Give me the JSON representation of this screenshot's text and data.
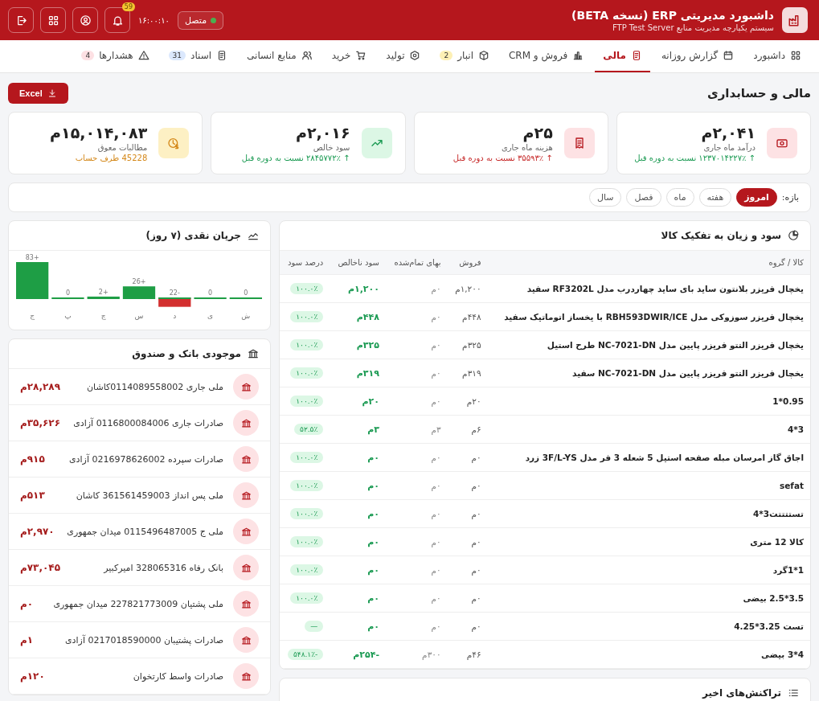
{
  "header": {
    "title": "داشبورد مدیریتی ERP (نسخه BETA)",
    "subtitle": "سیستم یکپارچه مدیریت منابع FTP Test Server",
    "status": {
      "label": "متصل",
      "online": true
    },
    "time": "۱۶:۰۰:۱۰",
    "notifications": "59"
  },
  "nav": [
    {
      "label": "داشبورد",
      "selected": false
    },
    {
      "label": "گزارش روزانه",
      "selected": false
    },
    {
      "label": "مالی",
      "selected": true
    },
    {
      "label": "فروش و CRM",
      "selected": false
    },
    {
      "label": "انبار",
      "selected": false,
      "badge": "2",
      "color": "#fdf0b5"
    },
    {
      "label": "تولید",
      "selected": false
    },
    {
      "label": "خرید",
      "selected": false
    },
    {
      "label": "منابع انسانی",
      "selected": false
    },
    {
      "label": "اسناد",
      "selected": false,
      "badge": "31",
      "color": "#dbe8fd"
    },
    {
      "label": "هشدارها",
      "selected": false,
      "badge": "4",
      "color": "#fde0e3"
    }
  ],
  "page": {
    "title": "مالی و حسابداری",
    "export_button": "Excel"
  },
  "kpis": [
    {
      "value": "۲,۰۴۱م",
      "label": "درآمد ماه جاری",
      "change": {
        "text": "↑ ۱۲۳۷۰۱۴۲۲۷٪ نسبت به دوره قبل",
        "color": "#1a9a52"
      },
      "color": "#fde2e4"
    },
    {
      "value": "۲۵م",
      "label": "هزینه ماه جاری",
      "change": {
        "text": "↑ ۳۵۵۹۳٪ نسبت به دوره قبل",
        "color": "#c62828"
      },
      "color": "#fde2e4"
    },
    {
      "value": "۲,۰۱۶م",
      "label": "سود خالص",
      "change": {
        "text": "↑ ۲۸۴۵۷۷۲٪ نسبت به دوره قبل",
        "color": "#1a9a52"
      },
      "color": "#dcf7e5"
    },
    {
      "value": "۱۵,۰۱۴,۰۸۳م",
      "label": "مطالبات معوق",
      "change": {
        "text": "45228 طرف حساب",
        "color": "#d4881a"
      },
      "color": "#fdf0c4"
    }
  ],
  "period": {
    "label": "بازه:",
    "options": [
      {
        "label": "امروز",
        "selected": true
      },
      {
        "label": "هفته",
        "selected": false
      },
      {
        "label": "ماه",
        "selected": false
      },
      {
        "label": "فصل",
        "selected": false
      },
      {
        "label": "سال",
        "selected": false
      }
    ]
  },
  "profit_table": {
    "title": "سود و زیان به تفکیک کالا",
    "columns": [
      "کالا / گروه",
      "فروش",
      "بهای تمام‌شده",
      "سود ناخالص",
      "درصد سود"
    ],
    "rows": [
      [
        "یخچال فریزر بلانتون ساید بای ساید چهاردرب مدل RF3202L سفید",
        "۱,۲۰۰م",
        "۰م",
        "۱,۲۰۰م",
        "۱۰۰.۰٪"
      ],
      [
        "یخچال فریزر سوزوکی مدل RBH593DWIR/ICE با یخساز اتوماتیک سفید",
        "۴۴۸م",
        "۰م",
        "۴۴۸م",
        "۱۰۰.۰٪"
      ],
      [
        "یخچال فریزر التتو فریزر پایین مدل NC-7021-DN طرح استیل",
        "۳۲۵م",
        "۰م",
        "۳۲۵م",
        "۱۰۰.۰٪"
      ],
      [
        "یخچال فریزر التتو فریزر پایین مدل NC-7021-DN سفید",
        "۳۱۹م",
        "۰م",
        "۳۱۹م",
        "۱۰۰.۰٪"
      ],
      [
        "0.95*1",
        "۲۰م",
        "۰م",
        "۲۰م",
        "۱۰۰.۰٪"
      ],
      [
        "3*4",
        "۶م",
        "۳م",
        "۳م",
        "۵۲.۵٪"
      ],
      [
        "اجاق گاز امرسان مبله صفحه استیل 5 شعله 3 فر مدل 3F/L-YS زرد",
        "۰م",
        "۰م",
        "۰م",
        "۱۰۰.۰٪"
      ],
      [
        "sefat",
        "۰م",
        "۰م",
        "۰م",
        "۱۰۰.۰٪"
      ],
      [
        "تستتتتت3*4",
        "۰م",
        "۰م",
        "۰م",
        "۱۰۰.۰٪"
      ],
      [
        "کالا 12 متری",
        "۰م",
        "۰م",
        "۰م",
        "۱۰۰.۰٪"
      ],
      [
        "1*1گرد",
        "۰م",
        "۰م",
        "۰م",
        "۱۰۰.۰٪"
      ],
      [
        "3.5*2.5 بیضی",
        "۰م",
        "۰م",
        "۰م",
        "۱۰۰.۰٪"
      ],
      [
        "تست 3.25*4.25",
        "۰م",
        "۰م",
        "۰م",
        "—"
      ],
      [
        "4*3 بیضی",
        "۴۶م",
        "۳۰۰م",
        "-۲۵۴م",
        "-۵۴۸.۱٪"
      ]
    ]
  },
  "transactions": {
    "title": "تراکنش‌های اخیر"
  },
  "cash_flow": {
    "title": "جریان نقدی (۷ روز)",
    "chart_data": {
      "type": "bar",
      "categories": [
        "ج",
        "پ",
        "چ",
        "س",
        "د",
        "ی",
        "ش"
      ],
      "values": [
        83,
        0,
        2,
        26,
        -22,
        0,
        0
      ],
      "value_labels": [
        "+83",
        "0",
        "+2",
        "+26",
        "-22",
        "0",
        "0"
      ]
    }
  },
  "banks": {
    "title": "موجودی بانک و صندوق",
    "items": [
      {
        "name": "ملی جاری 0114089558002کاشان",
        "amount": "۲۸,۲۸۹م"
      },
      {
        "name": "صادرات جاری 0116800084006 آزادی",
        "amount": "۳۵,۶۲۶م"
      },
      {
        "name": "صادرات سپرده 0216978626002 آزادی",
        "amount": "۹۱۵م"
      },
      {
        "name": "ملی پس انداز 361561459003 کاشان",
        "amount": "۵۱۳م"
      },
      {
        "name": "ملی ج 0115496487005 میدان جمهوری",
        "amount": "۲,۹۷۰م"
      },
      {
        "name": "بانک رفاه 328065316 امیرکبیر",
        "amount": "۷۳,۰۴۵م"
      },
      {
        "name": "ملی پشتیان 227821773009 میدان جمهوری",
        "amount": "۰م"
      },
      {
        "name": "صادرات پشتیبان 0217018590000 آزادی",
        "amount": "۱م"
      },
      {
        "name": "صادرات واسط کارتخوان",
        "amount": "۱۲۰م"
      }
    ]
  }
}
